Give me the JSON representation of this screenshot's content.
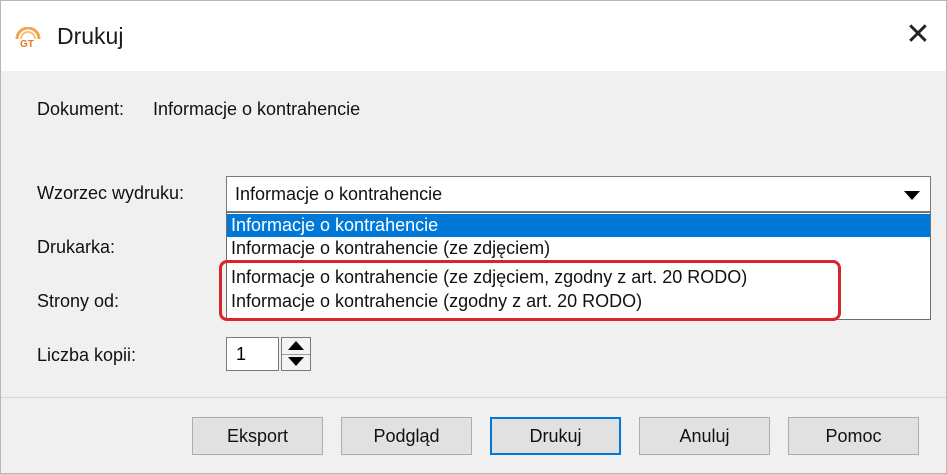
{
  "window": {
    "title": "Drukuj",
    "icon": "app-logo-icon",
    "close_symbol": "✕"
  },
  "form": {
    "document_label": "Dokument:",
    "document_value": "Informacje o kontrahencie",
    "template_label": "Wzorzec wydruku:",
    "template_selected": "Informacje o kontrahencie",
    "printer_label": "Drukarka:",
    "pages_label": "Strony od:",
    "copies_label": "Liczba kopii:",
    "copies_value": "1"
  },
  "dropdown": {
    "options": [
      "Informacje o kontrahencie",
      "Informacje o kontrahencie (ze zdjęciem)",
      "Informacje o kontrahencie (ze zdjęciem, zgodny z art. 20 RODO)",
      "Informacje o kontrahencie (zgodny z art. 20 RODO)"
    ],
    "selected_index": 0,
    "highlighted_indices": [
      2,
      3
    ],
    "highlight_color": "#d9242b",
    "selection_color": "#0078d7"
  },
  "buttons": {
    "export": "Eksport",
    "preview": "Podgląd",
    "print": "Drukuj",
    "cancel": "Anuluj",
    "help": "Pomoc"
  }
}
